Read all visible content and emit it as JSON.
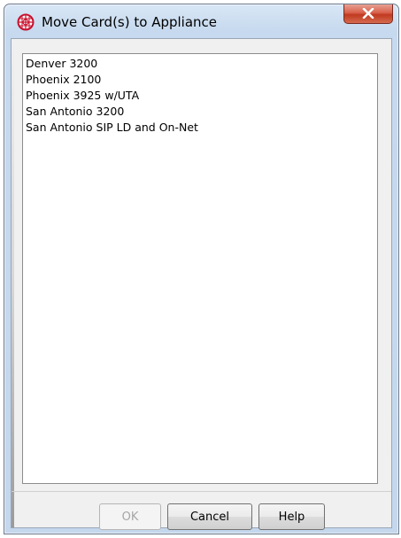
{
  "window": {
    "title": "Move Card(s) to Appliance",
    "app_icon": "globe-grid-icon",
    "close_icon": "close-x-icon",
    "accent": "#c8102e"
  },
  "list": {
    "items": [
      "Denver 3200",
      "Phoenix 2100",
      "Phoenix 3925 w/UTA",
      "San Antonio 3200",
      "San Antonio SIP LD and On-Net"
    ]
  },
  "buttons": {
    "ok": "OK",
    "cancel": "Cancel",
    "help": "Help"
  }
}
